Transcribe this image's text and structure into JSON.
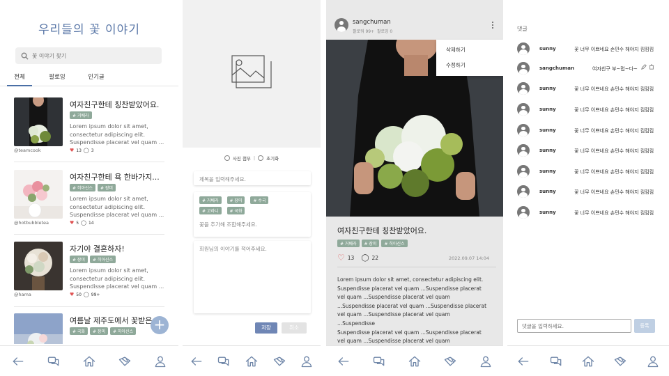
{
  "feed": {
    "app_title": "우리들의 꽃 이야기",
    "search_placeholder": "꽃 이야기 찾기",
    "tabs": [
      {
        "label": "전체"
      },
      {
        "label": "팔로잉"
      },
      {
        "label": "인기글"
      }
    ],
    "posts": [
      {
        "title": "여자친구한테 칭찬받았어요.",
        "tags": [
          "# 거베라"
        ],
        "excerpt": "Lorem ipsum dolor sit amet, consectetur adipiscing elit. Suspendisse placerat vel quam ...",
        "handle": "@teamcook",
        "likes": "13",
        "comments": "3"
      },
      {
        "title": "여자친구한테 욕 한바가지...",
        "tags": [
          "# 히아신스",
          "# 장미"
        ],
        "excerpt": "Lorem ipsum dolor sit amet, consectetur adipiscing elit. Suspendisse placerat vel quam ...",
        "handle": "@hotbubbletea",
        "likes": "5",
        "comments": "14"
      },
      {
        "title": "자기야 결혼하자!",
        "tags": [
          "# 장미",
          "# 히아신스"
        ],
        "excerpt": "Lorem ipsum dolor sit amet, consectetur adipiscing elit. Suspendisse placerat vel quam ...",
        "handle": "@hama",
        "likes": "50",
        "comments": "99+"
      },
      {
        "title": "여름날 제주도에서 꽃받은...",
        "tags": [
          "# 국화",
          "# 장미",
          "# 히아신스"
        ]
      }
    ],
    "fab_label": "+"
  },
  "compose": {
    "attach_photo_label": "사진 첨부",
    "reset_label": "초기화",
    "title_placeholder": "제목을 입력해주세요.",
    "flower_tags": [
      "# 거베라",
      "# 장미",
      "# 수국",
      "# 고라니",
      "# 국화"
    ],
    "flower_add_placeholder": "꽃을 추가해 조합해주세요.",
    "story_placeholder": "회원님의 이야기를 적어주세요.",
    "save_label": "저장",
    "cancel_label": "취소"
  },
  "detail": {
    "username": "sangchuman",
    "followers_label": "팔로워 99+",
    "following_label": "팔로잉 0",
    "menu": {
      "delete_label": "삭제하기",
      "edit_label": "수정하기"
    },
    "title": "여자친구한테 칭찬받았어요.",
    "tags": [
      "# 거베라",
      "# 장미",
      "# 히아신스"
    ],
    "likes": "13",
    "comments": "22",
    "date": "2022.09.07 14:04",
    "body_lines": [
      "Lorem ipsum dolor sit amet, consectetur adipiscing elit.",
      "Suspendisse placerat vel quam ...Suspendisse placerat",
      "vel quam ...Suspendisse placerat vel quam",
      "...Suspendisse placerat vel quam ...Suspendisse placerat",
      "vel quam ...Suspendisse placerat vel quam",
      "...Suspendisse",
      "Suspendisse placerat vel quam ...Suspendisse placerat",
      "vel quam ...Suspendisse placerat vel quam"
    ]
  },
  "comments": {
    "header": "댓글",
    "items": [
      {
        "name": "sunny",
        "text": "꽃 너무 이쁘네요 손민수 해야지 킴킴킴",
        "own": false
      },
      {
        "name": "sangchuman",
        "text": "여자친구 부~럽~다~",
        "own": true
      },
      {
        "name": "sunny",
        "text": "꽃 너무 이쁘네요 손민수 해야지 킴킴킴",
        "own": false
      },
      {
        "name": "sunny",
        "text": "꽃 너무 이쁘네요 손민수 해야지 킴킴킴",
        "own": false
      },
      {
        "name": "sunny",
        "text": "꽃 너무 이쁘네요 손민수 해야지 킴킴킴",
        "own": false
      },
      {
        "name": "sunny",
        "text": "꽃 너무 이쁘네요 손민수 해야지 킴킴킴",
        "own": false
      },
      {
        "name": "sunny",
        "text": "꽃 너무 이쁘네요 손민수 해야지 킴킴킴",
        "own": false
      },
      {
        "name": "sunny",
        "text": "꽃 너무 이쁘네요 손민수 해야지 킴킴킴",
        "own": false
      },
      {
        "name": "sunny",
        "text": "꽃 너무 이쁘네요 손민수 해야지 킴킴킴",
        "own": false
      }
    ],
    "input_placeholder": "댓글을 입력하세요.",
    "submit_label": "등록"
  },
  "nav_icons": [
    "back-arrow-icon",
    "chat-icon",
    "home-icon",
    "flower-wrap-icon",
    "profile-icon"
  ],
  "colors": {
    "accent": "#5b78a8",
    "tag": "#8fa99a",
    "save": "#6f86b5",
    "fab": "#9db4d4"
  }
}
